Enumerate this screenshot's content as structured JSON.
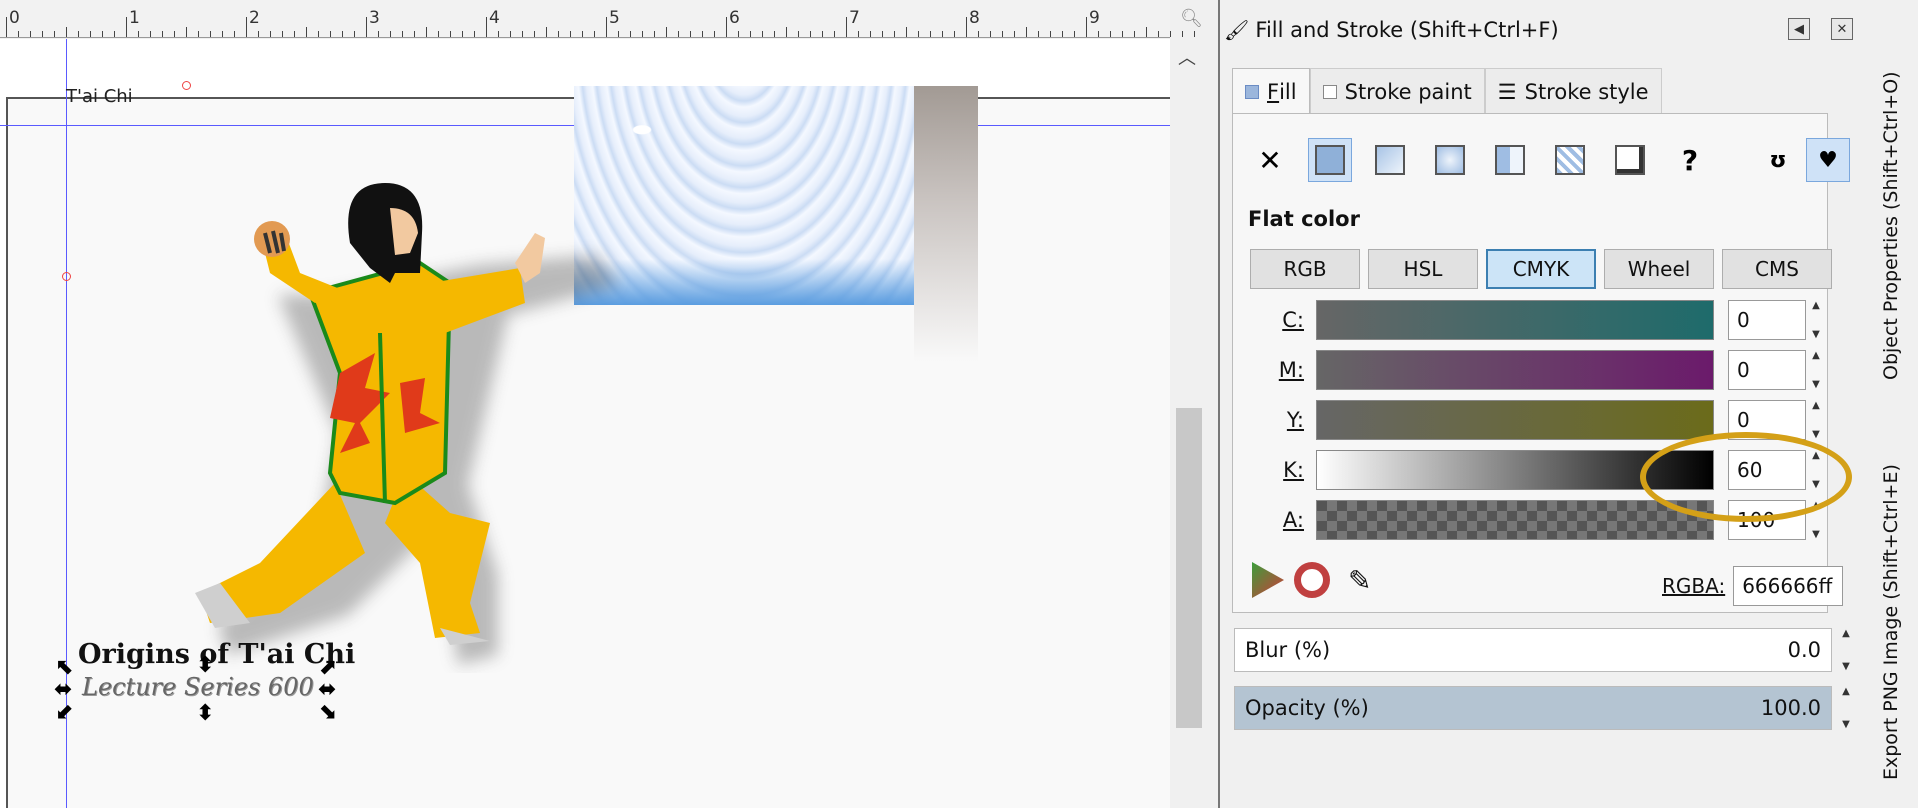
{
  "ruler": {
    "labels": [
      "0",
      "1",
      "2",
      "3",
      "4",
      "5",
      "6",
      "7",
      "8",
      "9"
    ],
    "zoom_icon": "zoom-icon"
  },
  "canvas": {
    "corner_label": "T'ai Chi",
    "title": "Origins of T'ai Chi",
    "subtitle": "Lecture Series 600"
  },
  "dialog": {
    "title": "Fill and Stroke (Shift+Ctrl+F)",
    "tabs": [
      {
        "label_prefix": "",
        "label_underlined": "F",
        "label_rest": "ill"
      },
      {
        "label": "Stroke paint"
      },
      {
        "label": "Stroke style"
      }
    ],
    "paint_types": [
      "none",
      "flat-color",
      "linear-gradient",
      "radial-gradient",
      "mesh",
      "pattern",
      "swatch",
      "unset"
    ],
    "unset_label": "?",
    "section_title": "Flat color",
    "modes": [
      "RGB",
      "HSL",
      "CMYK",
      "Wheel",
      "CMS"
    ],
    "sliders": [
      {
        "label": "C:",
        "value": "0"
      },
      {
        "label": "M:",
        "value": "0"
      },
      {
        "label": "Y:",
        "value": "0"
      },
      {
        "label": "K:",
        "value": "60"
      },
      {
        "label": "A:",
        "value": "100"
      }
    ],
    "rgba_label": "RGBA:",
    "rgba_value": "666666ff",
    "blur_label": "Blur (%)",
    "blur_value": "0.0",
    "opacity_label": "Opacity (%)",
    "opacity_value": "100.0"
  },
  "side_tabs": {
    "object_properties": "Object Properties (Shift+Ctrl+O)",
    "export_png": "Export PNG Image (Shift+Ctrl+E)"
  },
  "colors": {
    "accent_highlight": "#d4a017",
    "selected_mode": "#cce4f7",
    "guide": "#5a5aff"
  }
}
